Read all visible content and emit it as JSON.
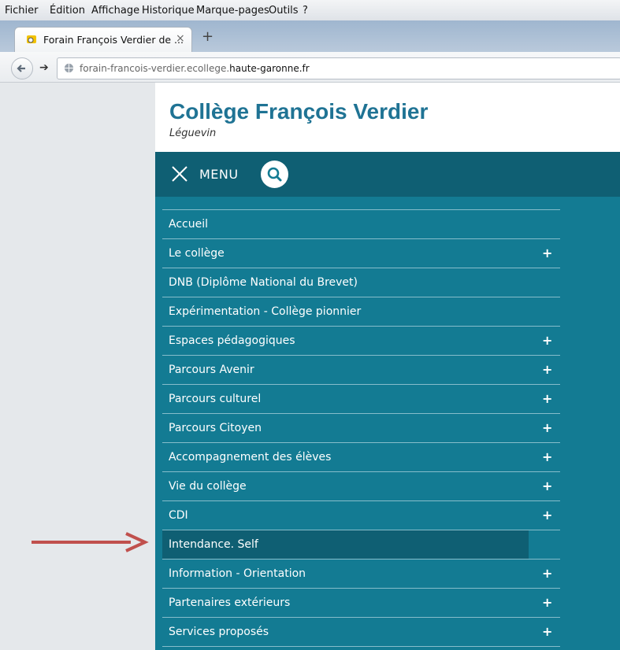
{
  "browser": {
    "menu": [
      "Fichier",
      "Édition",
      "Affichage",
      "Historique",
      "Marque-pages",
      "Outils",
      "?"
    ],
    "tab_title": "Forain François Verdier de ...",
    "tab_close": "×",
    "new_tab": "+",
    "url_prefix": "forain-francois-verdier.ecollege.",
    "url_domain": "haute-garonne.fr"
  },
  "site": {
    "title": "Collège François Verdier",
    "subtitle": "Léguevin",
    "menu_label": "MENU"
  },
  "nav": [
    {
      "label": "Accueil",
      "expandable": false
    },
    {
      "label": "Le collège",
      "expandable": true
    },
    {
      "label": "DNB (Diplôme National du Brevet)",
      "expandable": false
    },
    {
      "label": "Expérimentation - Collège pionnier",
      "expandable": false
    },
    {
      "label": "Espaces pédagogiques",
      "expandable": true
    },
    {
      "label": "Parcours Avenir",
      "expandable": true
    },
    {
      "label": "Parcours culturel",
      "expandable": true
    },
    {
      "label": "Parcours Citoyen",
      "expandable": true
    },
    {
      "label": "Accompagnement des élèves",
      "expandable": true
    },
    {
      "label": "Vie du collège",
      "expandable": true
    },
    {
      "label": "CDI",
      "expandable": true
    },
    {
      "label": "Intendance. Self",
      "expandable": false,
      "highlighted": true
    },
    {
      "label": "Information - Orientation",
      "expandable": true
    },
    {
      "label": "Partenaires extérieurs",
      "expandable": true
    },
    {
      "label": "Services proposés",
      "expandable": true
    }
  ],
  "icons": {
    "plus": "+",
    "close": "close-icon",
    "search": "search-icon",
    "annotation": "red-arrow-icon"
  },
  "colors": {
    "title": "#1f7394",
    "menu_bar": "#0f5f73",
    "nav_bg": "#137b93",
    "annotation_arrow": "#c0504d"
  }
}
